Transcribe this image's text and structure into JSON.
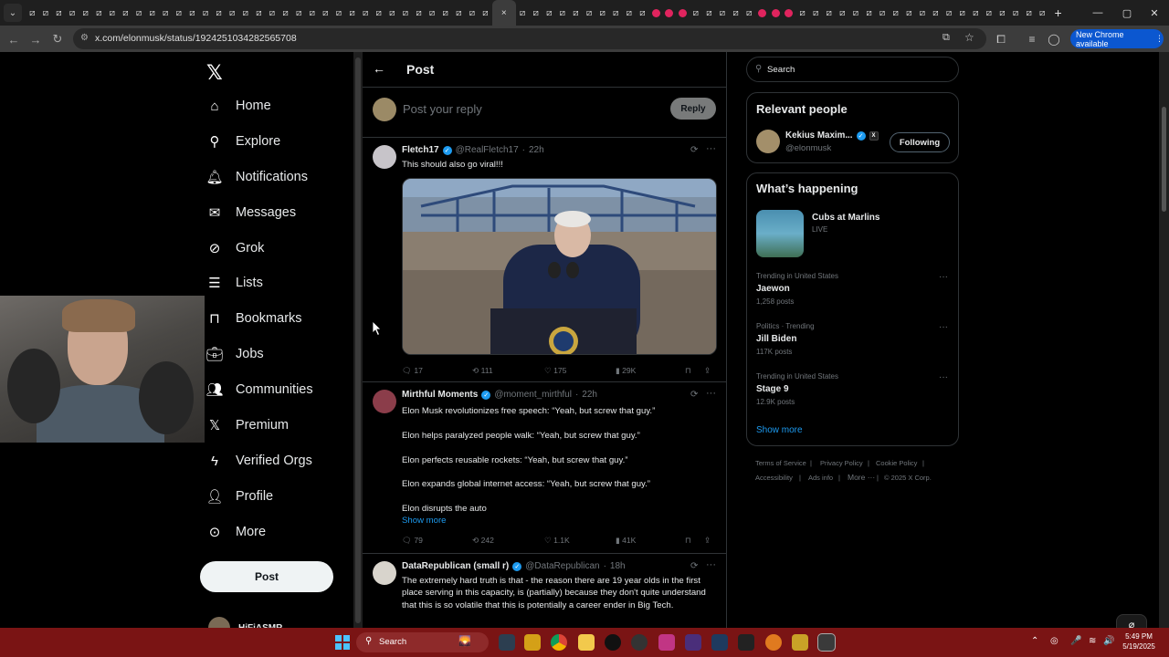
{
  "browser": {
    "url": "x.com/elonmusk/status/1924251034282565708",
    "new_chrome_label": "New Chrome available",
    "close_tab_glyph": "×",
    "new_tab_glyph": "+"
  },
  "nav": {
    "items": [
      {
        "label": "Home",
        "icon": "home-icon"
      },
      {
        "label": "Explore",
        "icon": "search-icon"
      },
      {
        "label": "Notifications",
        "icon": "bell-icon"
      },
      {
        "label": "Messages",
        "icon": "envelope-icon"
      },
      {
        "label": "Grok",
        "icon": "grok-icon"
      },
      {
        "label": "Lists",
        "icon": "list-icon"
      },
      {
        "label": "Bookmarks",
        "icon": "bookmark-icon"
      },
      {
        "label": "Jobs",
        "icon": "briefcase-icon"
      },
      {
        "label": "Communities",
        "icon": "people-icon"
      },
      {
        "label": "Premium",
        "icon": "x-icon"
      },
      {
        "label": "Verified Orgs",
        "icon": "bolt-icon"
      },
      {
        "label": "Profile",
        "icon": "person-icon"
      },
      {
        "label": "More",
        "icon": "more-circle-icon"
      }
    ],
    "post_button": "Post",
    "account_name": "HiFiASMR"
  },
  "main": {
    "header_title": "Post",
    "reply_placeholder": "Post your reply",
    "reply_button": "Reply",
    "posts": [
      {
        "name": "Fletch17",
        "handle": "@RealFletch17",
        "time": "22h",
        "text": "This should also go viral!!!",
        "replies": "17",
        "reposts": "111",
        "likes": "175",
        "views": "29K"
      },
      {
        "name": "Mirthful Moments",
        "handle": "@moment_mirthful",
        "time": "22h",
        "lines": [
          "Elon Musk revolutionizes free speech: “Yeah, but screw that guy.”",
          "Elon helps paralyzed people walk: “Yeah, but screw that guy.”",
          "Elon perfects reusable rockets: “Yeah, but screw that guy.”",
          "Elon expands global internet access: “Yeah, but screw that guy.”",
          "Elon disrupts the auto"
        ],
        "show_more": "Show more",
        "replies": "79",
        "reposts": "242",
        "likes": "1.1K",
        "views": "41K"
      },
      {
        "name": "DataRepublican (small r)",
        "handle": "@DataRepublican",
        "time": "18h",
        "text": "The extremely hard truth is that - the reason there are 19 year olds in the first place serving in this capacity, is (partially) because they don't quite understand that this is so volatile that this is potentially a career ender in Big Tech."
      }
    ]
  },
  "right": {
    "search_placeholder": "Search",
    "relevant_title": "Relevant people",
    "person_name": "Kekius Maxim...",
    "person_handle": "@elonmusk",
    "follow_button": "Following",
    "happening_title": "What’s happening",
    "event_title": "Cubs at Marlins",
    "event_status": "LIVE",
    "trends": [
      {
        "meta": "Trending in United States",
        "topic": "Jaewon",
        "count": "1,258 posts"
      },
      {
        "meta": "Politics · Trending",
        "topic": "Jill Biden",
        "count": "117K posts"
      },
      {
        "meta": "Trending in United States",
        "topic": "Stage 9",
        "count": "12.9K posts"
      }
    ],
    "show_more": "Show more",
    "footer": [
      "Terms of Service",
      "Privacy Policy",
      "Cookie Policy",
      "Accessibility",
      "Ads info",
      "More ···",
      "© 2025 X Corp."
    ]
  },
  "taskbar": {
    "search_label": "Search",
    "time": "5:49 PM",
    "date": "5/19/2025"
  },
  "colors": {
    "accent": "#1d9bf0",
    "taskbar": "#7a1414",
    "chrome_button": "#0b57d0"
  }
}
